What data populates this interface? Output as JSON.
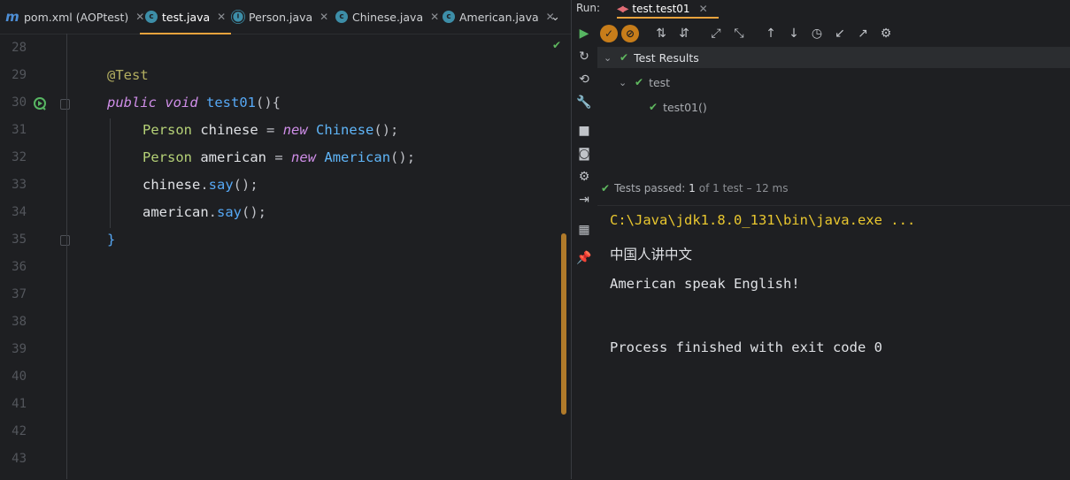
{
  "editor": {
    "tabs": [
      {
        "label": "pom.xml (AOPtest)",
        "icon": "maven-icon",
        "active": false
      },
      {
        "label": "test.java",
        "icon": "java-test-class-icon",
        "active": true
      },
      {
        "label": "Person.java",
        "icon": "java-interface-icon",
        "active": false
      },
      {
        "label": "Chinese.java",
        "icon": "java-class-icon",
        "active": false
      },
      {
        "label": "American.java",
        "icon": "java-class-icon",
        "active": false
      }
    ],
    "more_tabs_icon": "chevron-down-icon",
    "line_numbers": [
      "28",
      "29",
      "30",
      "31",
      "32",
      "33",
      "34",
      "35",
      "36",
      "37",
      "38",
      "39",
      "40",
      "41",
      "42",
      "43"
    ],
    "code": {
      "l29": {
        "ann": "@Test"
      },
      "l30": {
        "kw1": "public",
        "kw2": "void",
        "name": "test01",
        "rest": "(){"
      },
      "l31": {
        "type": "Person",
        "var": "chinese",
        "eq": "=",
        "kw": "new",
        "cls": "Chinese",
        "rest": "();"
      },
      "l32": {
        "type": "Person",
        "var": "american",
        "eq": "=",
        "kw": "new",
        "cls": "American",
        "rest": "();"
      },
      "l33": {
        "obj": "chinese",
        "dot": ".",
        "call": "say",
        "rest": "();"
      },
      "l34": {
        "obj": "american",
        "dot": ".",
        "call": "say",
        "rest": "();"
      },
      "l35": {
        "brace": "}"
      }
    }
  },
  "run": {
    "label": "Run:",
    "tab_label": "test.test01",
    "tree": {
      "root": "Test Results",
      "child": "test",
      "leaf": "test01()"
    },
    "status": {
      "prefix": "Tests passed:",
      "passed": "1",
      "of_total": "of 1 test",
      "time": "– 12 ms"
    },
    "console_lines": [
      "C:\\Java\\jdk1.8.0_131\\bin\\java.exe ...",
      "中国人讲中文",
      "American speak English!",
      "",
      "Process finished with exit code 0"
    ]
  },
  "colors": {
    "accent": "#e8a33d",
    "pass": "#5fb85f",
    "path": "#e9c72f"
  }
}
